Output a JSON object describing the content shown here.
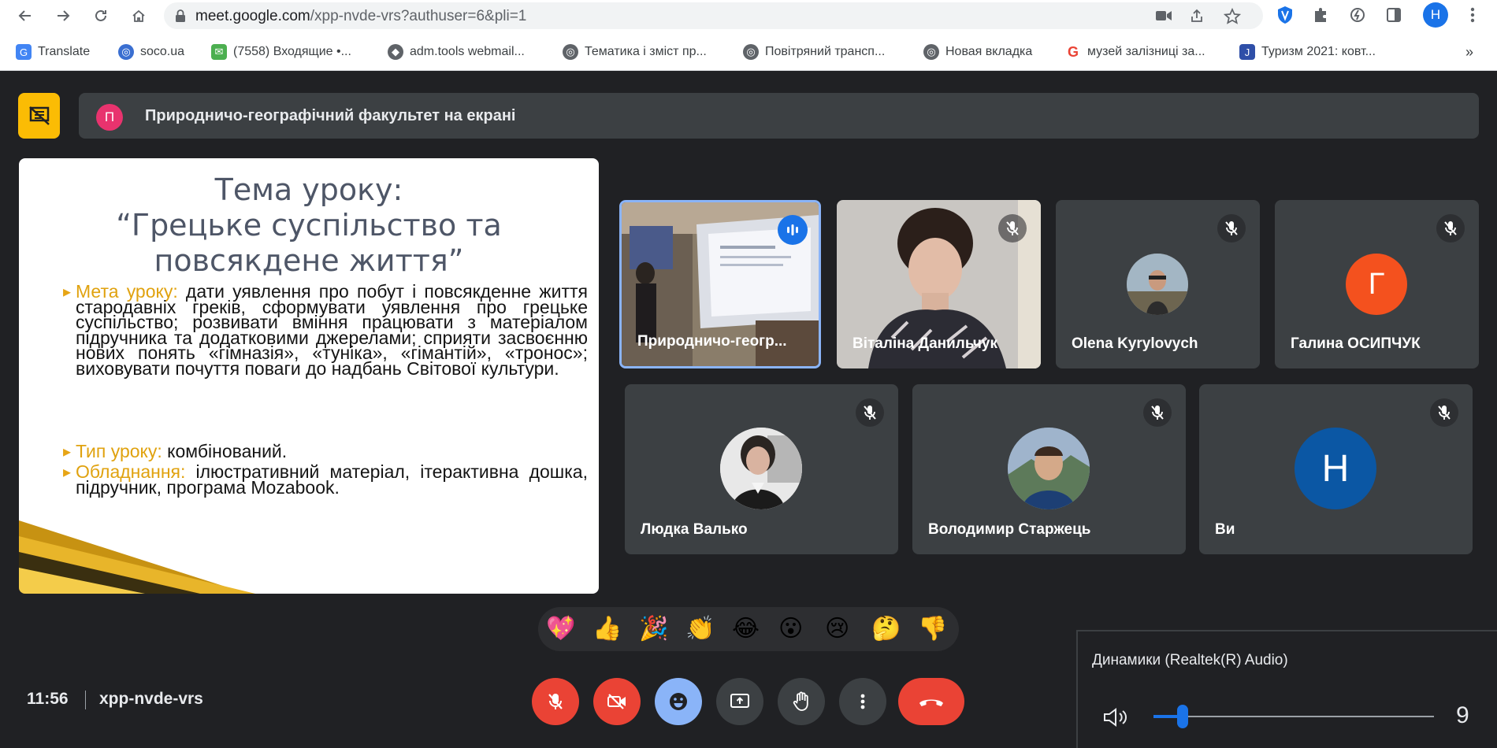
{
  "browser": {
    "url_host": "meet.google.com",
    "url_path": "/xpp-nvde-vrs?authuser=6&pli=1",
    "profile_initial": "Н",
    "bookmarks": [
      {
        "label": "Translate",
        "icon": "translate-icon",
        "color": "#4285f4"
      },
      {
        "label": "soco.ua",
        "icon": "globe-icon",
        "color": "#3a6fd1"
      },
      {
        "label": "(7558) Входящие •...",
        "icon": "mail-icon",
        "color": "#4caf50"
      },
      {
        "label": "adm.tools webmail...",
        "icon": "webmail-icon",
        "color": "#5f6368"
      },
      {
        "label": "Тематика і зміст пр...",
        "icon": "globe-icon",
        "color": "#5f6368"
      },
      {
        "label": "Повітряний трансп...",
        "icon": "globe-icon",
        "color": "#5f6368"
      },
      {
        "label": "Новая вкладка",
        "icon": "globe-icon",
        "color": "#5f6368"
      },
      {
        "label": "музей залізниці за...",
        "icon": "google-icon",
        "color": "#ea4335"
      },
      {
        "label": "Туризм 2021: ковт...",
        "icon": "doc-icon",
        "color": "#2f4fa8"
      }
    ],
    "more_bookmarks": "»"
  },
  "meet": {
    "presenting_avatar": "П",
    "presenting_text": "Природничо-географічний факультет на екрані",
    "slide": {
      "title_1": "Тема уроку:",
      "title_2": "“Грецьке суспільство та",
      "title_3": "повсякдене життя”",
      "goal_label": "Мета уроку:",
      "goal_text": " дати уявлення про побут і повсякденне життя стародавніх греків, сформувати уявлення про грецьке суспільство; розвивати вміння працювати з матеріалом підручника та додатковими джерелами; сприяти засвоєнню нових понять «гімназія», «туніка», «гімантій», «тронос»; виховувати почуття поваги до надбань Світової культури.",
      "type_label": "Тип уроку:",
      "type_text": " комбінований.",
      "equip_label": "Обладнання:",
      "equip_text": " ілюстративний матеріал, ітерактивна дошка, підручник, програма Mozabook."
    },
    "participants": [
      {
        "name": "Природничо-геогр...",
        "speaking": true
      },
      {
        "name": "Віталіна Данильчук",
        "muted": true
      },
      {
        "name": "Olena Kyrylovych",
        "muted": true
      },
      {
        "name": "Галина ОСИПЧУК",
        "muted": true,
        "initial": "Г",
        "color": "#f4511e"
      },
      {
        "name": "Людка Валько",
        "muted": true
      },
      {
        "name": "Володимир Старжець",
        "muted": true
      },
      {
        "name": "Ви",
        "muted": true,
        "initial": "Н",
        "color": "#0b57a4"
      }
    ],
    "reactions": [
      "💖",
      "👍",
      "🎉",
      "👏",
      "😂",
      "😮",
      "😢",
      "🤔",
      "👎"
    ],
    "time": "11:56",
    "meeting_code": "xpp-nvde-vrs",
    "colors": {
      "danger": "#ea4335",
      "accent": "#8ab4f8",
      "control": "#3c4043"
    }
  },
  "volume_popup": {
    "device": "Динамики (Realtek(R) Audio)",
    "level": "9",
    "level_fraction": 0.09
  }
}
